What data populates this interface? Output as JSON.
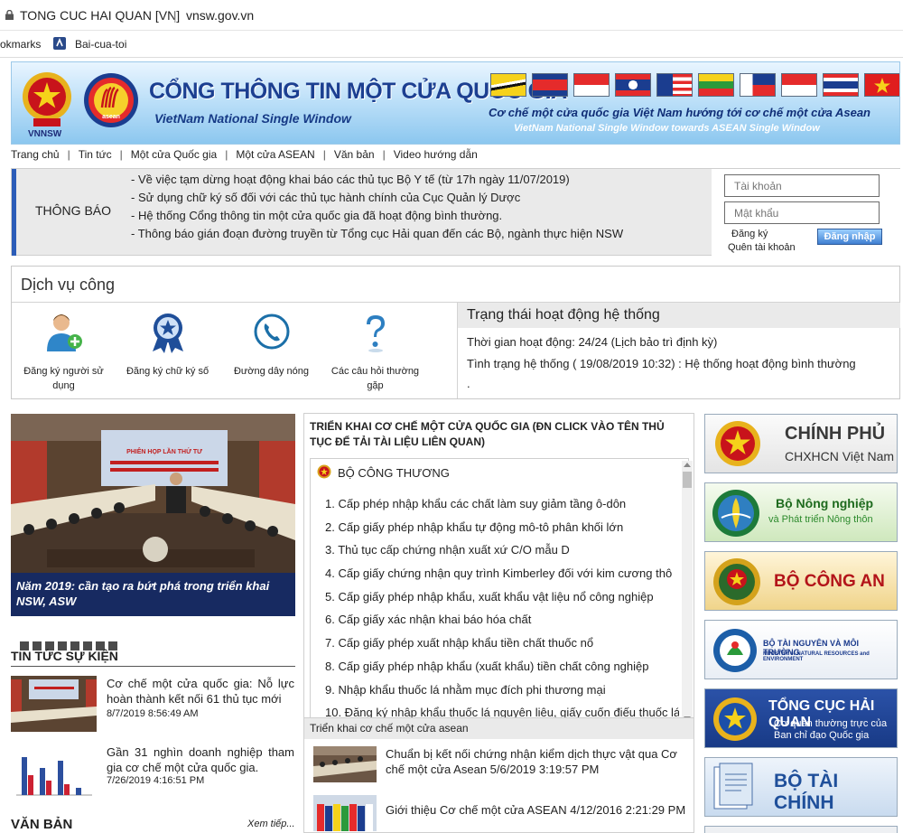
{
  "browser": {
    "tab_title": "TONG CUC HAI QUAN [VN]",
    "separator": "|",
    "url": "vnsw.gov.vn",
    "bookmarks": [
      "okmarks",
      "Bai-cua-toi"
    ]
  },
  "banner": {
    "vnnsw": "VNNSW",
    "title": "CỔNG THÔNG TIN MỘT CỬA QUỐC GIA",
    "subtitle": "VietNam National Single Window",
    "right_line1": "Cơ chế một cửa quốc gia Việt Nam hướng tới cơ chế một cửa Asean",
    "right_line2": "VietNam National Single Window towards ASEAN Single Window"
  },
  "nav": [
    "Trang chủ",
    "Tin tức",
    "Một cửa Quốc gia",
    "Một cửa ASEAN",
    "Văn bản",
    "Video hướng dẫn"
  ],
  "notice": {
    "label": "THÔNG BÁO",
    "items": [
      "- Về việc tạm dừng hoạt động khai báo các thủ tục Bộ Y tế (từ 17h ngày 11/07/2019)",
      "- Sử dụng chữ ký số đối với các thủ tục hành chính của Cục Quản lý Dược",
      "- Hệ thống Cổng thông tin một cửa quốc gia đã hoạt động bình thường.",
      "- Thông báo gián đoạn đường truyền từ Tổng cục Hải quan đến các Bộ, ngành thực hiện NSW"
    ]
  },
  "login": {
    "account_placeholder": "Tài khoản",
    "password_placeholder": "Mật khẩu",
    "register": "Đăng ký",
    "forgot": "Quên tài khoản",
    "login_button": "Đăng nhập"
  },
  "services": {
    "title": "Dịch vụ công",
    "items": [
      {
        "label": "Đăng ký người sử dụng",
        "icon": "user-add-icon"
      },
      {
        "label": "Đăng ký chữ ký số",
        "icon": "medal-icon"
      },
      {
        "label": "Đường dây nóng",
        "icon": "phone-icon"
      },
      {
        "label": "Các câu hỏi thường gặp",
        "icon": "question-icon"
      }
    ]
  },
  "system_status": {
    "title": "Trạng thái hoạt động hệ thống",
    "line1": "Thời gian hoạt động: 24/24 (Lịch bảo trì định kỳ)",
    "line2": "Tình trạng hệ thống ( 19/08/2019 10:32) : Hệ thống hoạt động bình thường",
    "line3": "."
  },
  "feature": {
    "caption": "Năm 2019: cần tạo ra bứt phá trong triển khai NSW, ASW",
    "banner_text": "PHIÊN HỌP LẦN THỨ TƯ"
  },
  "news": {
    "title": "TIN TỨC SỰ KIỆN",
    "items": [
      {
        "text": "Cơ chế một cửa quốc gia: Nỗ lực hoàn thành kết nối 61 thủ tục mới",
        "date": "8/7/2019 8:56:49 AM"
      },
      {
        "text": "Gần 31 nghìn doanh nghiệp tham gia cơ chế một cửa quốc gia.",
        "date": "7/26/2019 4:16:51 PM"
      }
    ]
  },
  "docs": {
    "title": "VĂN BẢN",
    "more": "Xem tiếp..."
  },
  "procedures": {
    "heading": "TRIỂN KHAI CƠ CHẾ MỘT CỬA QUỐC GIA (ĐN CLICK VÀO TÊN THỦ TỤC ĐỂ TẢI TÀI LIỆU LIÊN QUAN)",
    "ministry": "BỘ CÔNG THƯƠNG",
    "items": [
      "1. Cấp phép nhập khẩu các chất làm suy giảm tầng ô-dôn",
      "2. Cấp giấy phép nhập khẩu tự động mô-tô phân khối lớn",
      "3. Thủ tục cấp chứng nhận xuất xứ C/O mẫu D",
      "4. Cấp giấy chứng nhận quy trình Kimberley đối với kim cương thô",
      "5. Cấp giấy phép nhập khẩu, xuất khẩu vật liệu nổ công nghiệp",
      "6. Cấp giấy xác nhận khai báo hóa chất",
      "7. Cấp giấy phép xuất nhập khẩu tiền chất thuốc nổ",
      "8. Cấp giấy phép nhập khẩu (xuất khẩu) tiền chất công nghiệp",
      "9. Nhập khẩu thuốc lá nhằm mục đích phi thương mại",
      "10. Đăng ký nhập khẩu thuốc lá nguyên liệu, giấy cuốn điếu thuốc lá"
    ]
  },
  "asean": {
    "title": "Triển khai cơ chế một cửa asean",
    "items": [
      {
        "text": "Chuẩn bị kết nối chứng nhận kiểm dịch thực vật qua Cơ chế một cửa Asean 5/6/2019 3:19:57 PM"
      },
      {
        "text": "Giới thiệu Cơ chế một cửa ASEAN 4/12/2016 2:21:29 PM"
      }
    ]
  },
  "partners": [
    {
      "title": "CHÍNH PHỦ",
      "subtitle": "CHXHCN Việt Nam"
    },
    {
      "title": "Bộ Nông nghiệp",
      "subtitle": "và Phát triển Nông thôn"
    },
    {
      "title": "BỘ CÔNG AN",
      "subtitle": ""
    },
    {
      "title": "BỘ TÀI NGUYÊN VÀ MÔI TRƯỜNG",
      "subtitle": "MINISTRY of NATURAL RESOURCES and ENVIRONMENT"
    },
    {
      "title": "TỔNG CỤC HẢI QUAN",
      "subtitle": "Cơ quan thường trực của Ban chỉ đạo Quốc gia"
    },
    {
      "title": "BỘ TÀI CHÍNH",
      "subtitle": ""
    }
  ],
  "colors": {
    "brand_blue": "#1c3f91",
    "notice_bar": "#2b5cb8",
    "customs_blue": "#1a3a8c"
  }
}
